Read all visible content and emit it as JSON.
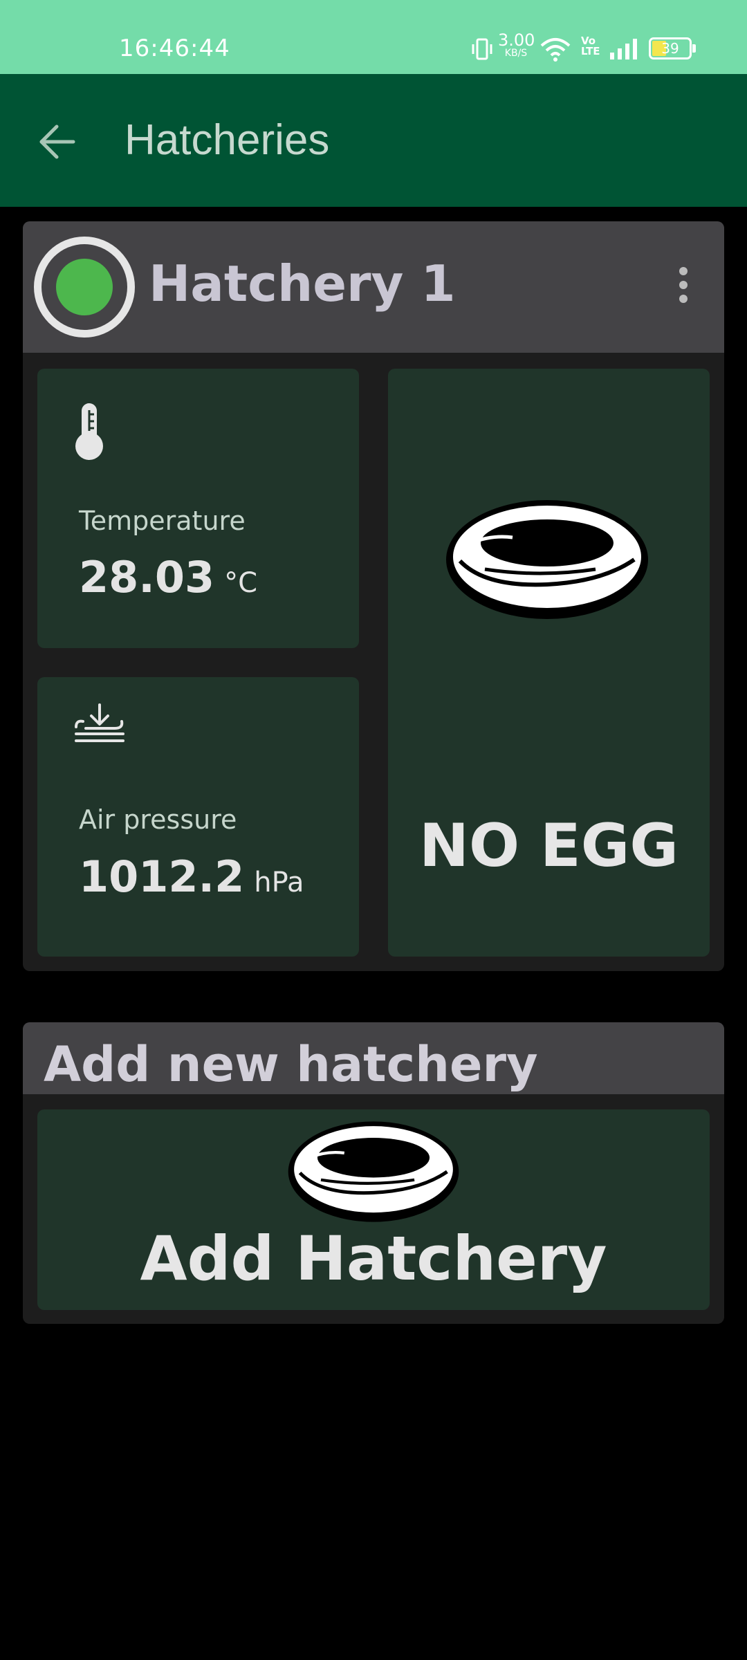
{
  "status_bar": {
    "time": "16:46:44",
    "network_speed": "3.00",
    "network_speed_unit": "KB/S",
    "battery_level": "39",
    "icons": [
      "vibrate-icon",
      "wifi-icon",
      "volte-icon",
      "signal-icon",
      "battery-icon"
    ]
  },
  "app_bar": {
    "title": "Hatcheries",
    "back_icon": "arrow-left-icon"
  },
  "hatchery": {
    "name": "Hatchery 1",
    "status_color": "#4db74d",
    "temperature": {
      "label": "Temperature",
      "value": "28.03",
      "unit": "°C",
      "icon": "thermometer-icon"
    },
    "air_pressure": {
      "label": "Air pressure",
      "value": "1012.2",
      "unit": "hPa",
      "icon": "pressure-icon"
    },
    "egg_status": "NO EGG",
    "menu_icon": "more-vertical-icon"
  },
  "add_section": {
    "title": "Add new hatchery",
    "button_label": "Add Hatchery"
  },
  "colors": {
    "status_bar": "#74dca9",
    "app_bar": "#005434",
    "card": "#1d1d1d",
    "card_header": "#444346",
    "tile": "#20352a"
  }
}
